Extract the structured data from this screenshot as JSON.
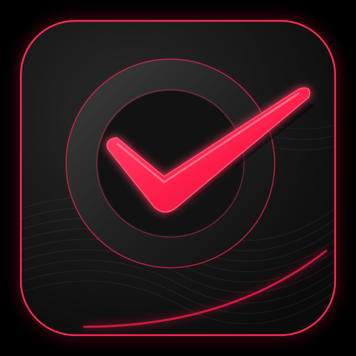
{
  "icon": {
    "name": "checkmark-app-icon",
    "glyph": "check-circle-icon"
  },
  "colors": {
    "background": "#000000",
    "tile": "#141414",
    "tile_edge": "#2a2a2a",
    "glow": "#ff1f4b",
    "ring": "#2b2b2b",
    "check": "#ff2a55",
    "check_shadow": "#b0122f"
  }
}
